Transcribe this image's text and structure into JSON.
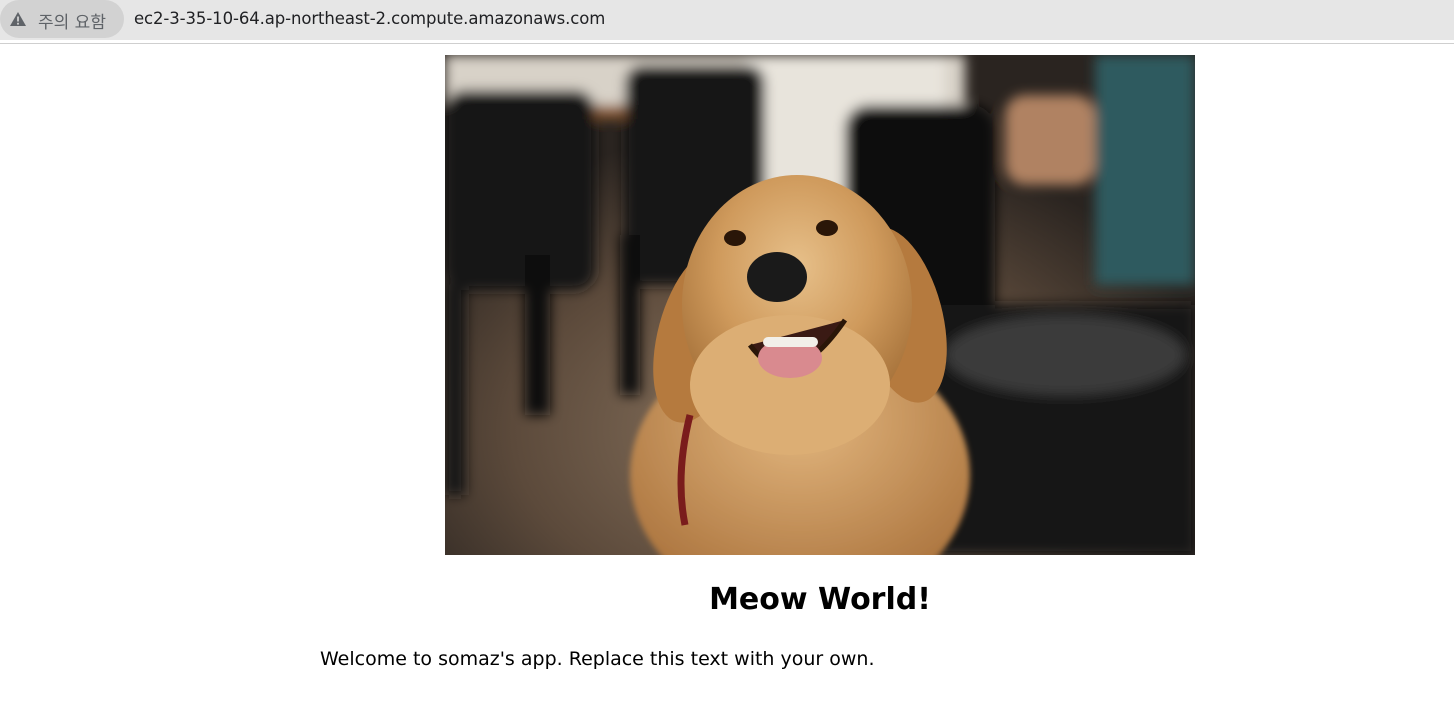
{
  "browser": {
    "security_label": "주의 요함",
    "url": "ec2-3-35-10-64.ap-northeast-2.compute.amazonaws.com",
    "security_icon": "warning-triangle-icon"
  },
  "page": {
    "image": "dog-photo",
    "heading": "Meow World!",
    "welcome": "Welcome to somaz's app. Replace this text with your own."
  },
  "colors": {
    "address_bar": "#e6e6e6",
    "security_chip": "#d2d2d2",
    "page_background": "#ffffff"
  }
}
